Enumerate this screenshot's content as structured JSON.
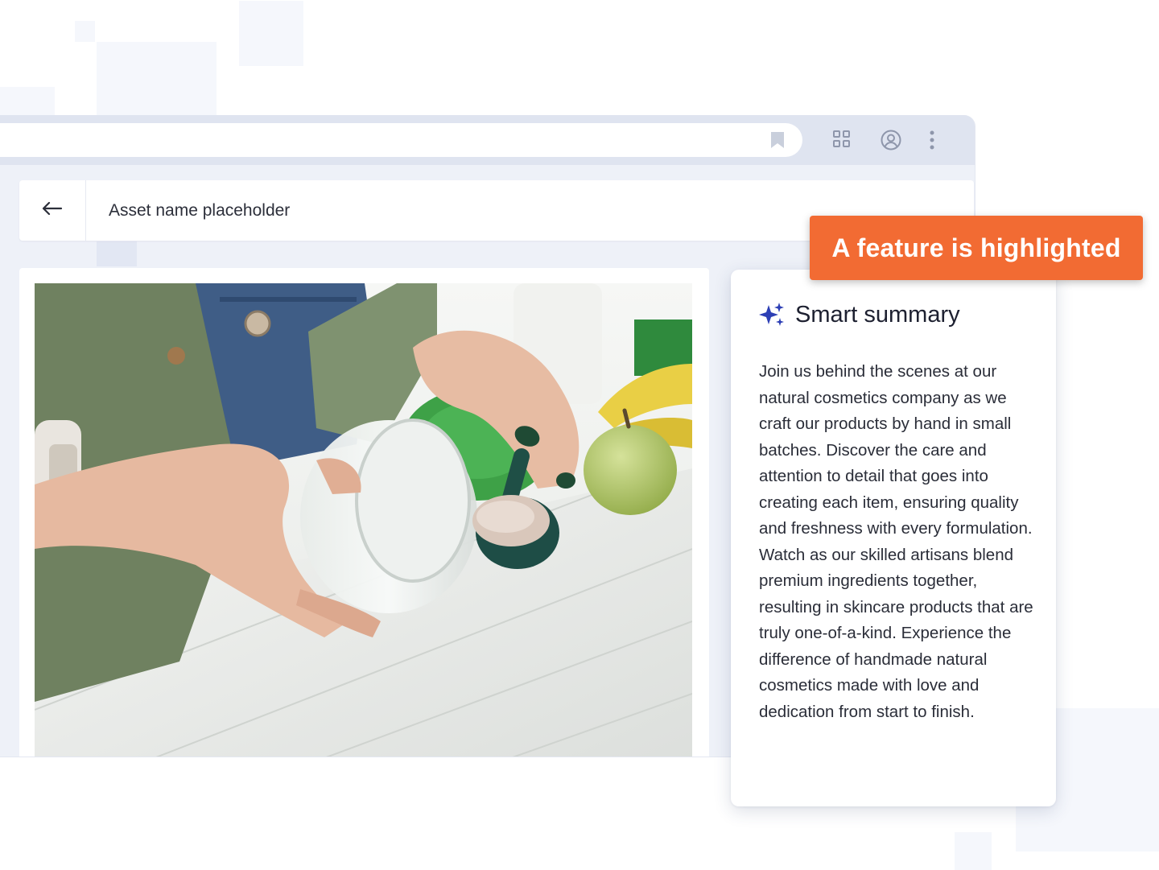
{
  "header": {
    "title": "Asset name placeholder",
    "back_icon": "arrow-left-icon"
  },
  "browser": {
    "bookmark_icon": "bookmark-icon",
    "apps_icon": "grid-icon",
    "profile_icon": "user-circle-icon",
    "menu_icon": "more-vertical-icon"
  },
  "media": {
    "image_description_icon": "photo"
  },
  "summary": {
    "title": "Smart summary",
    "icon": "sparkle-icon",
    "text": "Join us behind the scenes at our natural cosmetics company as we craft our products by hand in small batches. Discover the care and attention to detail that goes into creating each item, ensuring quality and freshness with every formulation. Watch as our skilled artisans blend premium ingredients together, resulting in skincare products that are truly one-of-a-kind. Experience the difference of handmade natural cosmetics made with love and dedication from start to finish."
  },
  "callout": {
    "label": "A feature is highlighted",
    "color": "#f26b33"
  },
  "colors": {
    "accent_icon": "#2d3fb5",
    "chrome": "#dfe4f0"
  }
}
